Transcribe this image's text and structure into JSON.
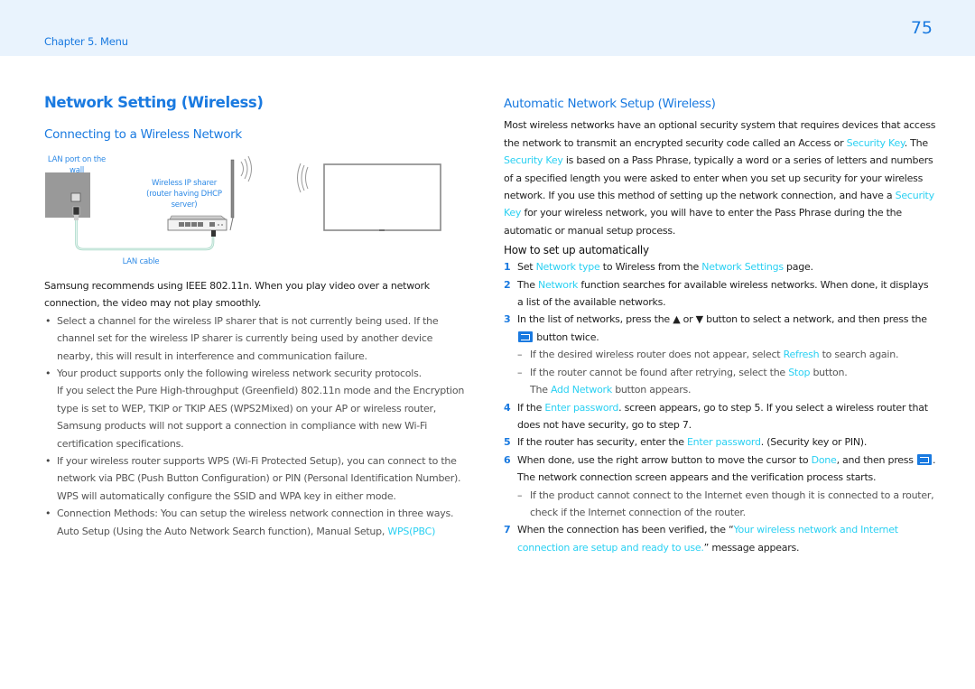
{
  "header": {
    "chapter": "Chapter 5. Menu",
    "page_number": "75"
  },
  "left": {
    "title": "Network Setting (Wireless)",
    "subtitle": "Connecting to a Wireless Network",
    "diagram": {
      "lan_port_label_1": "LAN port on the",
      "lan_port_label_2": "wall",
      "sharer_label_1": "Wireless IP sharer",
      "sharer_label_2": "(router having DHCP",
      "sharer_label_3": "server)",
      "cable_label": "LAN cable"
    },
    "intro": "Samsung recommends using IEEE 802.11n. When you play video over a network connection, the video may not play smoothly.",
    "bullets": [
      "Select a channel for the wireless IP sharer that is not currently being used. If the channel set for the wireless IP sharer is currently being used by another device nearby, this will result in interference and communication failure.",
      "Your product supports only the following wireless network security protocols.",
      "If you select the Pure High-throughput (Greenfield) 802.11n mode and the Encryption type is set to WEP, TKIP or TKIP AES (WPS2Mixed) on your AP or wireless router, Samsung products will not support a connection in compliance with new Wi-Fi certification specifications.",
      "If your wireless router supports WPS (Wi-Fi Protected Setup), you can connect to the network via PBC (Push Button Configuration) or PIN (Personal Identification Number). WPS will automatically configure the SSID and WPA key in either mode.",
      "Connection Methods: You can setup the wireless network connection in three ways. Auto Setup (Using the Auto Network Search function), Manual Setup, ",
      "WPS(PBC)"
    ]
  },
  "right": {
    "title": "Automatic Network Setup (Wireless)",
    "para": {
      "p1": "Most wireless networks have an optional security system that requires devices that access the network to transmit an encrypted security code called an Access or ",
      "k1": "Security Key",
      "p2": ". The ",
      "k2": "Security Key",
      "p3": " is based on a Pass Phrase, typically a word or a series of letters and numbers of a specified length you were asked to enter when you set up security for your wireless network. If you use this method of setting up the network connection, and have a ",
      "k3": "Security Key",
      "p4": " for your wireless network, you will have to enter the Pass Phrase during the the automatic or manual setup process."
    },
    "howto_title": "How to set up automatically",
    "steps": {
      "s1": {
        "num": "1",
        "a": "Set ",
        "k1": "Network type",
        "b": " to Wireless from the ",
        "k2": "Network Settings",
        "c": " page."
      },
      "s2": {
        "num": "2",
        "a": "The ",
        "k1": "Network",
        "b": " function searches for available wireless networks. When done, it displays a list of the available networks."
      },
      "s3": {
        "num": "3",
        "a": "In the list of networks, press the ▲ or ▼ button to select a network, and then press the ",
        "b": " button twice.",
        "n1a": "If the desired wireless router does not appear, select ",
        "n1k": "Refresh",
        "n1b": " to search again.",
        "n2a": "If the router cannot be found after retrying, select the ",
        "n2k": "Stop",
        "n2b": " button.",
        "n2c": "The ",
        "n2k2": "Add Network",
        "n2d": " button appears."
      },
      "s4": {
        "num": "4",
        "a": "If the ",
        "k1": "Enter password",
        "b": ". screen appears, go to step 5. If you select a wireless router that does not have security, go to step 7."
      },
      "s5": {
        "num": "5",
        "a": "If the router has security, enter the ",
        "k1": "Enter password",
        "b": ". (Security key or PIN)."
      },
      "s6": {
        "num": "6",
        "a": "When done, use the right arrow button to move the cursor to ",
        "k1": "Done",
        "b": ", and then press ",
        "c": ". The network connection screen appears and the verification process starts.",
        "n1": "If the product cannot connect to the Internet even though it is connected to a router, check if the Internet connection of the router."
      },
      "s7": {
        "num": "7",
        "a": "When the connection has been verified, the “",
        "k1": "Your wireless network and Internet connection are setup and ready to use.",
        "b": "” message appears."
      }
    }
  },
  "icons": {
    "enter_button": "enter-icon",
    "up": "▲",
    "down": "▼"
  },
  "colors": {
    "brand_blue": "#1a7ae0",
    "highlight_cyan": "#2ad0f2",
    "header_bg": "#e9f3fd"
  }
}
